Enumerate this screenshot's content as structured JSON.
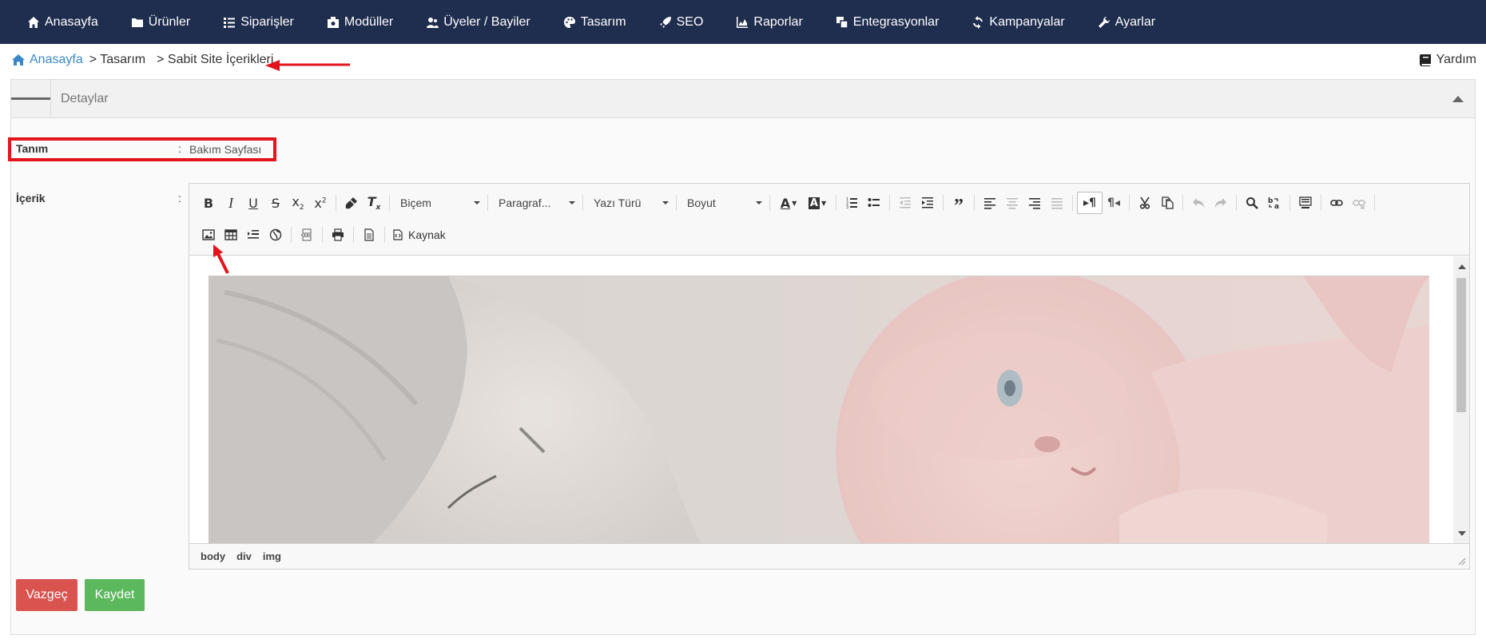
{
  "nav": {
    "items": [
      {
        "label": "Anasayfa",
        "icon": "home-icon"
      },
      {
        "label": "Ürünler",
        "icon": "folder-icon"
      },
      {
        "label": "Siparişler",
        "icon": "list-icon"
      },
      {
        "label": "Modüller",
        "icon": "module-icon"
      },
      {
        "label": "Üyeler / Bayiler",
        "icon": "users-icon"
      },
      {
        "label": "Tasarım",
        "icon": "palette-icon"
      },
      {
        "label": "SEO",
        "icon": "rocket-icon"
      },
      {
        "label": "Raporlar",
        "icon": "chart-icon"
      },
      {
        "label": "Entegrasyonlar",
        "icon": "windows-icon"
      },
      {
        "label": "Kampanyalar",
        "icon": "refresh-icon"
      },
      {
        "label": "Ayarlar",
        "icon": "wrench-icon"
      }
    ]
  },
  "breadcrumb": {
    "home": "Anasayfa",
    "items": [
      "> Tasarım",
      "> Sabit Site İçerikleri"
    ]
  },
  "help": {
    "label": "Yardım"
  },
  "panel": {
    "title": "Detaylar"
  },
  "form": {
    "tanim": {
      "label": "Tanım",
      "colon": ":",
      "value": "Bakım Sayfası"
    },
    "icerik": {
      "label": "İçerik",
      "colon": ":"
    }
  },
  "editor": {
    "combos": {
      "style": "Biçem",
      "format": "Paragraf...",
      "font": "Yazı Türü",
      "size": "Boyut"
    },
    "source_label": "Kaynak",
    "path": [
      "body",
      "div",
      "img"
    ]
  },
  "buttons": {
    "cancel": "Vazgeç",
    "save": "Kaydet"
  },
  "colors": {
    "nav_bg": "#1f2d4e",
    "link": "#3a87c8",
    "annotation": "#e3141b",
    "cancel": "#d9534f",
    "save": "#5cb85c"
  }
}
